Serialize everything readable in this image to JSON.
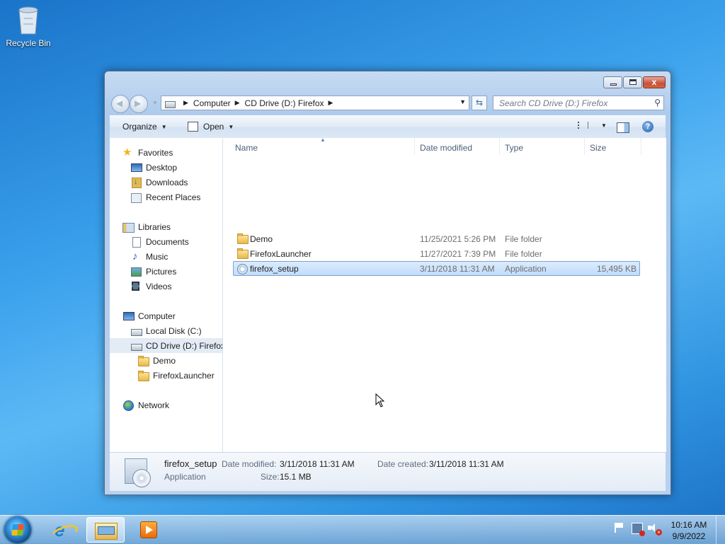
{
  "desktop": {
    "recycle_bin_label": "Recycle Bin"
  },
  "window": {
    "caption": {
      "minimize": "minimize",
      "maximize": "maximize",
      "close": "x"
    },
    "address": {
      "crumbs": [
        "Computer",
        "CD Drive (D:) Firefox"
      ]
    },
    "search": {
      "placeholder": "Search CD Drive (D:) Firefox"
    },
    "toolbar": {
      "organize": "Organize",
      "open": "Open"
    },
    "navpane": {
      "favorites": "Favorites",
      "favorites_items": [
        "Desktop",
        "Downloads",
        "Recent Places"
      ],
      "libraries": "Libraries",
      "libraries_items": [
        "Documents",
        "Music",
        "Pictures",
        "Videos"
      ],
      "computer": "Computer",
      "computer_items": [
        "Local Disk (C:)",
        "CD Drive (D:) Firefox"
      ],
      "cd_children": [
        "Demo",
        "FirefoxLauncher"
      ],
      "network": "Network"
    },
    "columns": {
      "name": "Name",
      "date": "Date modified",
      "type": "Type",
      "size": "Size"
    },
    "files": [
      {
        "name": "Demo",
        "date": "11/25/2021 5:26 PM",
        "type": "File folder",
        "size": ""
      },
      {
        "name": "FirefoxLauncher",
        "date": "11/27/2021 7:39 PM",
        "type": "File folder",
        "size": ""
      },
      {
        "name": "firefox_setup",
        "date": "3/11/2018 11:31 AM",
        "type": "Application",
        "size": "15,495 KB"
      }
    ],
    "details": {
      "name": "firefox_setup",
      "type": "Application",
      "date_modified_label": "Date modified:",
      "date_modified": "3/11/2018 11:31 AM",
      "date_created_label": "Date created:",
      "date_created": "3/11/2018 11:31 AM",
      "size_label": "Size:",
      "size": "15.1 MB"
    }
  },
  "taskbar": {
    "clock_time": "10:16 AM",
    "clock_date": "9/9/2022"
  }
}
